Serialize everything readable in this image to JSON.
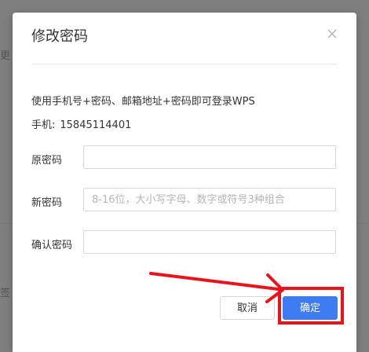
{
  "background": {
    "fragments": [
      "更",
      "签"
    ]
  },
  "dialog": {
    "title": "修改密码",
    "close_icon": "close-icon",
    "description": "使用手机号+密码、邮箱地址+密码即可登录WPS",
    "phone_label": "手机:",
    "phone_number": "15845114401",
    "fields": {
      "old_password": {
        "label": "原密码",
        "placeholder": "",
        "value": ""
      },
      "new_password": {
        "label": "新密码",
        "placeholder": "8-16位，大小写字母、数字或符号3种组合",
        "value": ""
      },
      "confirm_password": {
        "label": "确认密码",
        "placeholder": "",
        "value": ""
      }
    },
    "cancel_label": "取消",
    "ok_label": "确定"
  },
  "annotation": {
    "color": "#e8131b"
  },
  "colors": {
    "accent": "#3f7cf4",
    "annotation": "#e8131b"
  }
}
